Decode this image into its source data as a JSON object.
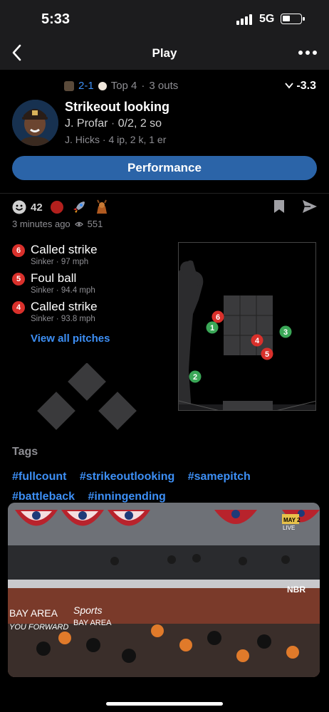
{
  "status_bar": {
    "time": "5:33",
    "network": "5G"
  },
  "nav": {
    "title": "Play"
  },
  "game": {
    "score": "2-1",
    "inning": "Top 4",
    "outs": "3 outs",
    "wpa": "-3.3"
  },
  "play": {
    "title": "Strikeout looking",
    "batter": "J. Profar",
    "batter_stats": "0/2, 2 so",
    "pitcher": "J. Hicks",
    "pitcher_stats": "4 ip, 2 k, 1 er"
  },
  "performance_button": "Performance",
  "reactions": {
    "smile_count": "42"
  },
  "meta": {
    "posted": "3 minutes ago",
    "views": "551"
  },
  "pitches": [
    {
      "num": "6",
      "result": "Called strike",
      "type": "Sinker",
      "speed": "97 mph"
    },
    {
      "num": "5",
      "result": "Foul ball",
      "type": "Sinker",
      "speed": "94.4 mph"
    },
    {
      "num": "4",
      "result": "Called strike",
      "type": "Sinker",
      "speed": "93.8 mph"
    }
  ],
  "view_all": "View all pitches",
  "zone_markers": [
    {
      "num": "6",
      "color": "#d9302b"
    },
    {
      "num": "1",
      "color": "#3aa757"
    },
    {
      "num": "4",
      "color": "#d9302b"
    },
    {
      "num": "5",
      "color": "#d9302b"
    },
    {
      "num": "3",
      "color": "#3aa757"
    },
    {
      "num": "2",
      "color": "#3aa757"
    }
  ],
  "tags_title": "Tags",
  "tags": [
    "#fullcount",
    "#strikeoutlooking",
    "#samepitch",
    "#battleback",
    "#inningending"
  ],
  "video": {
    "overlay_badge": "MAY 2",
    "live_label": "LIVE",
    "sign_left_1": "BAY AREA",
    "sign_left_2": "YOU FORWARD",
    "sign_sports": "Sports",
    "sign_area": "BAY AREA",
    "sign_right": "NBR"
  },
  "colors": {
    "accent": "#3d8ff5",
    "button": "#2b64a8",
    "strike": "#d9302b",
    "ball": "#3aa757"
  }
}
